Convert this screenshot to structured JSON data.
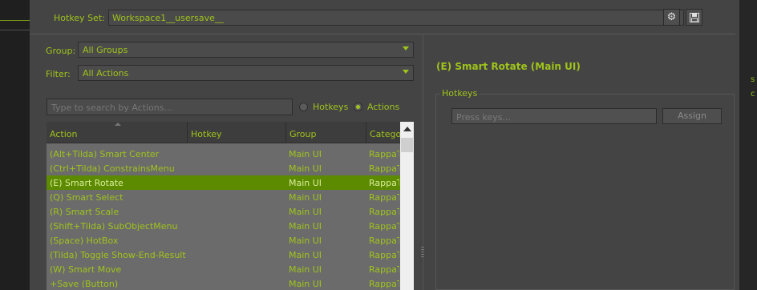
{
  "hotkey_set": {
    "label": "Hotkey Set:",
    "value": "Workspace1__usersave__"
  },
  "icons": {
    "settings": "gear-icon",
    "save": "floppy-disk-icon"
  },
  "group": {
    "label": "Group:",
    "value": "All Groups"
  },
  "filter": {
    "label": "Filter:",
    "value": "All Actions"
  },
  "search": {
    "placeholder": "Type to search by Actions..."
  },
  "search_mode": {
    "hotkeys_label": "Hotkeys",
    "actions_label": "Actions",
    "selected": "Actions"
  },
  "table": {
    "columns": [
      "Action",
      "Hotkey",
      "Group",
      "Categor"
    ],
    "rows": [
      {
        "action": "(Alt+Tilda) Smart Center",
        "hotkey": "",
        "group": "Main UI",
        "category": "RappaT"
      },
      {
        "action": "(Ctrl+Tilda) ConstrainsMenu",
        "hotkey": "",
        "group": "Main UI",
        "category": "RappaT"
      },
      {
        "action": "(E) Smart Rotate",
        "hotkey": "",
        "group": "Main UI",
        "category": "RappaT",
        "selected": true
      },
      {
        "action": "(Q) Smart Select",
        "hotkey": "",
        "group": "Main UI",
        "category": "RappaT"
      },
      {
        "action": "(R) Smart Scale",
        "hotkey": "",
        "group": "Main UI",
        "category": "RappaT"
      },
      {
        "action": "(Shift+Tilda) SubObjectMenu",
        "hotkey": "",
        "group": "Main UI",
        "category": "RappaT"
      },
      {
        "action": "(Space) HotBox",
        "hotkey": "",
        "group": "Main UI",
        "category": "RappaT"
      },
      {
        "action": "(Tilda) Toggle Show-End-Result",
        "hotkey": "",
        "group": "Main UI",
        "category": "RappaT"
      },
      {
        "action": "(W) Smart Move",
        "hotkey": "",
        "group": "Main UI",
        "category": "RappaT"
      },
      {
        "action": "+Save (Button)",
        "hotkey": "",
        "group": "Main UI",
        "category": "RappaT"
      }
    ]
  },
  "detail": {
    "title": "(E) Smart Rotate (Main UI)",
    "hotkeys_group_label": "Hotkeys",
    "press_keys_placeholder": "Press keys...",
    "assign_label": "Assign"
  },
  "colors": {
    "accent": "#9fc41a",
    "selection": "#5c8a00",
    "panel": "#444444"
  }
}
